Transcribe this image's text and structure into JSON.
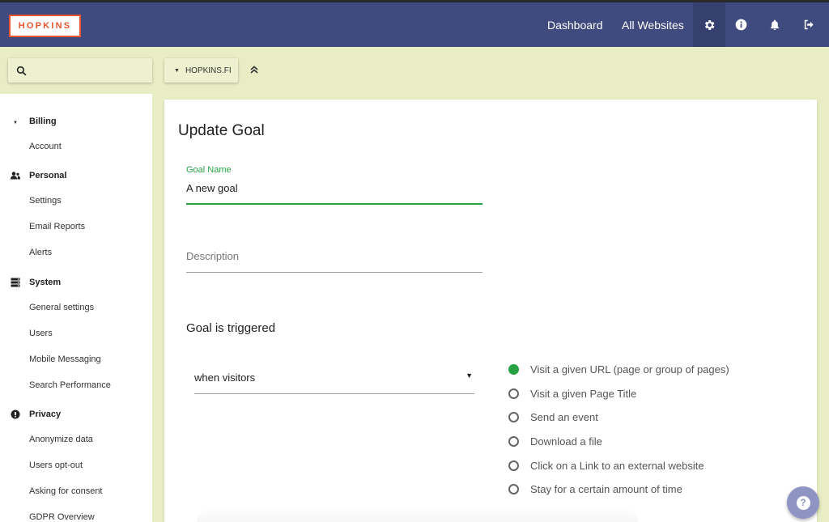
{
  "header": {
    "logo_text": "HOPKINS",
    "nav": {
      "dashboard": "Dashboard",
      "all_websites": "All Websites"
    },
    "icons": [
      "gear-icon",
      "info-icon",
      "bell-icon",
      "logout-icon"
    ]
  },
  "toolbar": {
    "search": {
      "value": "",
      "placeholder": ""
    },
    "site_selector": "HOPKINS.FI"
  },
  "sidebar": {
    "sections": [
      {
        "label": "Billing",
        "icon": "caret-down-icon",
        "items": [
          "Account"
        ]
      },
      {
        "label": "Personal",
        "icon": "users-icon",
        "items": [
          "Settings",
          "Email Reports",
          "Alerts"
        ]
      },
      {
        "label": "System",
        "icon": "server-icon",
        "items": [
          "General settings",
          "Users",
          "Mobile Messaging",
          "Search Performance"
        ]
      },
      {
        "label": "Privacy",
        "icon": "privacy-icon",
        "items": [
          "Anonymize data",
          "Users opt-out",
          "Asking for consent",
          "GDPR Overview"
        ]
      }
    ]
  },
  "main": {
    "title": "Update Goal",
    "goal_name": {
      "label": "Goal Name",
      "value": "A new goal"
    },
    "description": {
      "placeholder": "Description",
      "value": ""
    },
    "trigger": {
      "heading": "Goal is triggered",
      "select_value": "when visitors",
      "options": [
        {
          "label": "Visit a given URL (page or group of pages)",
          "selected": true
        },
        {
          "label": "Visit a given Page Title",
          "selected": false
        },
        {
          "label": "Send an event",
          "selected": false
        },
        {
          "label": "Download a file",
          "selected": false
        },
        {
          "label": "Click on a Link to an external website",
          "selected": false
        },
        {
          "label": "Stay for a certain amount of time",
          "selected": false
        }
      ]
    }
  },
  "help": {
    "icon": "help-icon",
    "glyph": "?"
  },
  "colors": {
    "header": "#3f4a7e",
    "accent_green": "#26a244",
    "page_bg": "#e8edc4",
    "logo": "#e8542f",
    "help_button": "#8f95c2"
  }
}
